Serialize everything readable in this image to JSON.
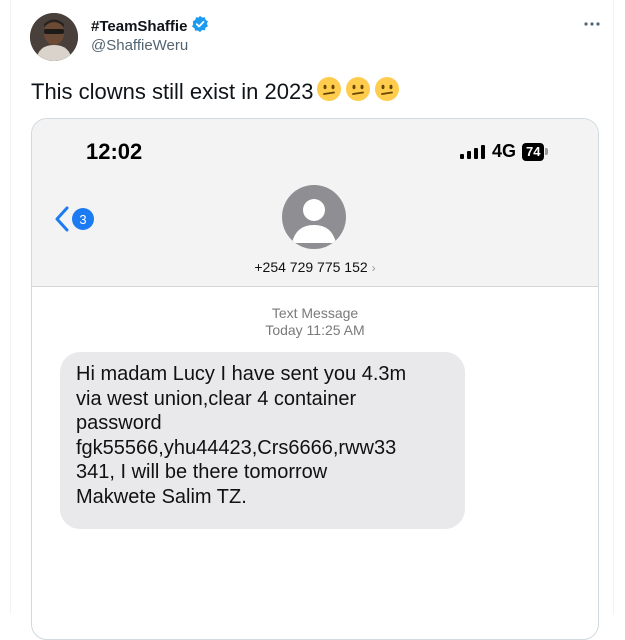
{
  "tweet": {
    "display_name": "#TeamShaffie",
    "handle": "@ShaffieWeru",
    "text": "This clowns still exist in 2023",
    "emoji_count": 3,
    "verified_color": "#1d9bf0"
  },
  "phone": {
    "time": "12:02",
    "network": "4G",
    "battery": "74",
    "back_badge": "3",
    "contact_number": "+254 729 775 152",
    "meta_label": "Text Message",
    "meta_time": "Today 11:25 AM",
    "message": "Hi madam Lucy I have sent you 4.3m\nvia west union,clear 4 container\npassword\nfgk55566,yhu44423,Crs6666,rww33\n341, I will be there tomorrow\nMakwete Salim TZ.",
    "accent_color": "#1a7bf2"
  }
}
